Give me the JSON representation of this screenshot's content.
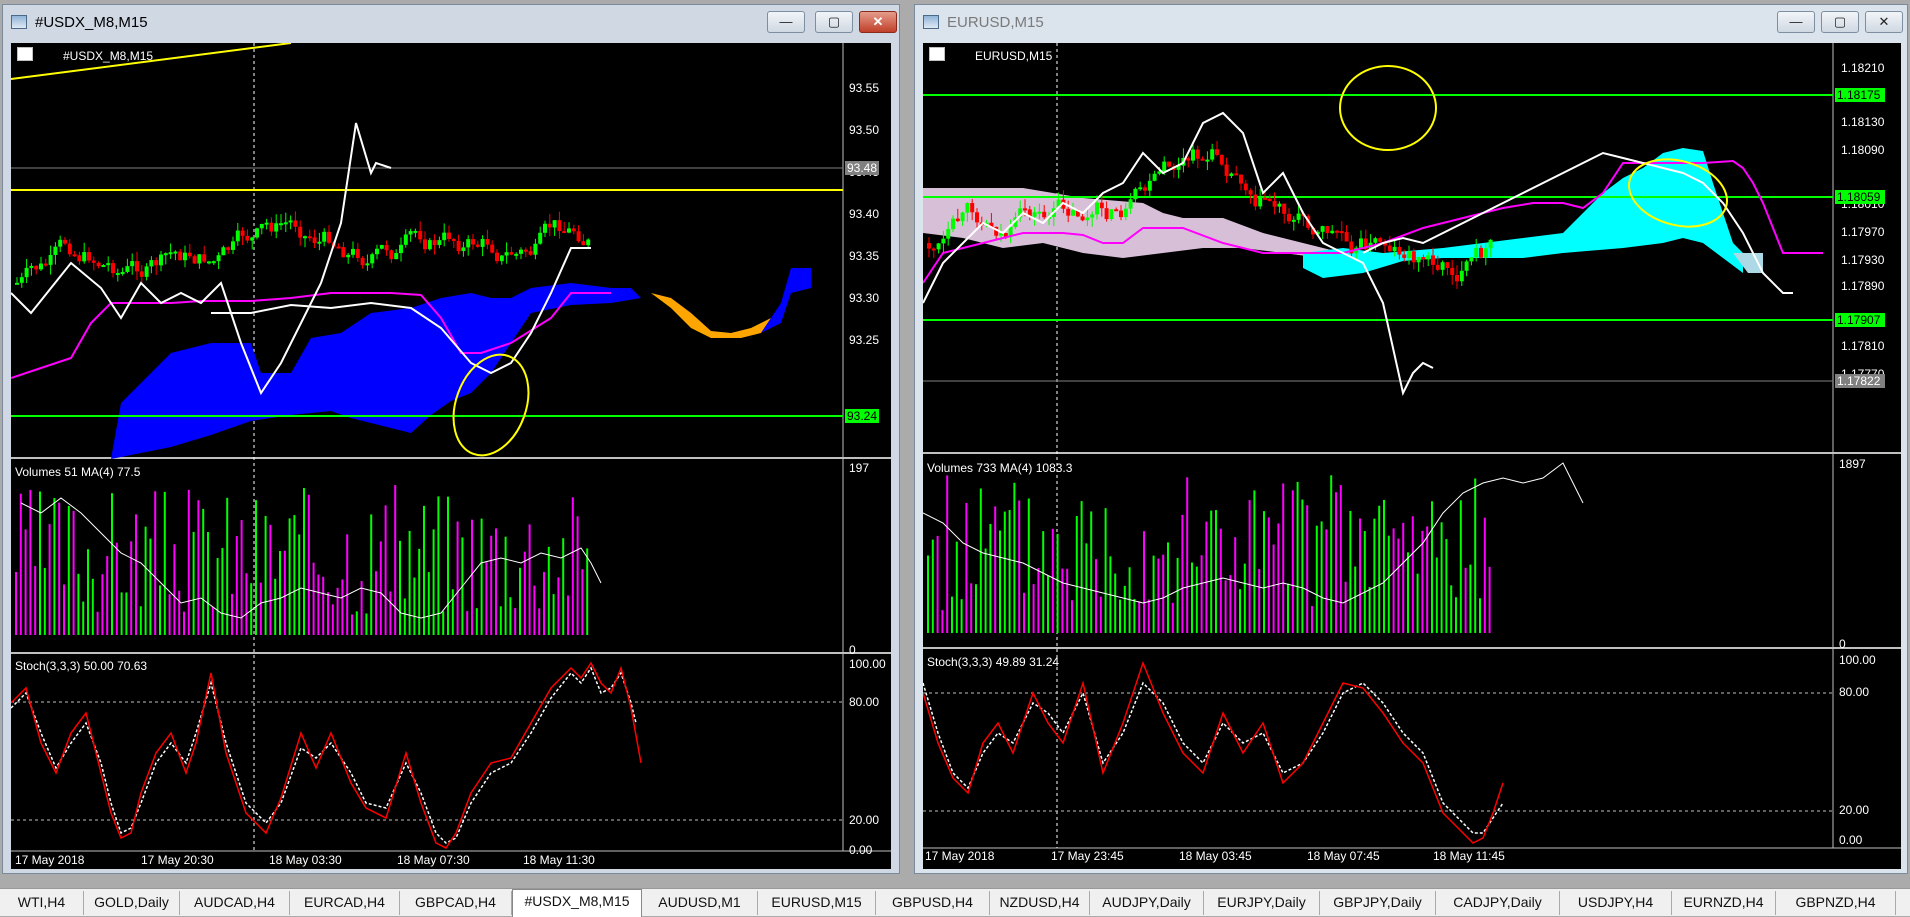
{
  "left_window": {
    "title": "#USDX_M8,M15",
    "chart_label": "#USDX_M8,M15",
    "volume_label": "Volumes 51 MA(4) 77.5",
    "stoch_label": "Stoch(3,3,3) 50.00 70.63",
    "price_ticks": [
      "93.55",
      "93.50",
      "93.45",
      "93.40",
      "93.35",
      "93.30",
      "93.25"
    ],
    "bid_marker": "93.48",
    "line_marker": "93.24",
    "volume_ticks": [
      "197",
      "0"
    ],
    "stoch_ticks": [
      "100.00",
      "80.00",
      "20.00",
      "0.00"
    ],
    "time_labels": [
      "17 May 2018",
      "17 May 20:30",
      "18 May 03:30",
      "18 May 07:30",
      "18 May 11:30"
    ]
  },
  "right_window": {
    "title": "EURUSD,M15",
    "chart_label": "EURUSD,M15",
    "volume_label": "Volumes 733 MA(4) 1083.3",
    "stoch_label": "Stoch(3,3,3) 49.89 31.24",
    "price_ticks": [
      "1.18210",
      "1.18130",
      "1.18090",
      "1.18010",
      "1.17970",
      "1.17930",
      "1.17890",
      "1.17850",
      "1.17810",
      "1.17770"
    ],
    "upper_marker": "1.18175",
    "mid_marker": "1.18059",
    "lower_marker": "1.17907",
    "bid_marker": "1.17822",
    "volume_ticks": [
      "1897",
      "0"
    ],
    "stoch_ticks": [
      "100.00",
      "80.00",
      "20.00",
      "0.00"
    ],
    "time_labels": [
      "17 May 2018",
      "17 May 23:45",
      "18 May 03:45",
      "18 May 07:45",
      "18 May 11:45"
    ]
  },
  "window_buttons": {
    "minimize": "—",
    "maximize": "▢",
    "close": "✕"
  },
  "tabs": [
    {
      "label": "WTI,H4",
      "active": false
    },
    {
      "label": "GOLD,Daily",
      "active": false
    },
    {
      "label": "AUDCAD,H4",
      "active": false
    },
    {
      "label": "EURCAD,H4",
      "active": false
    },
    {
      "label": "GBPCAD,H4",
      "active": false
    },
    {
      "label": "#USDX_M8,M15",
      "active": true
    },
    {
      "label": "AUDUSD,M1",
      "active": false
    },
    {
      "label": "EURUSD,M15",
      "active": false
    },
    {
      "label": "GBPUSD,H4",
      "active": false
    },
    {
      "label": "NZDUSD,H4",
      "active": false
    },
    {
      "label": "AUDJPY,Daily",
      "active": false
    },
    {
      "label": "EURJPY,Daily",
      "active": false
    },
    {
      "label": "GBPJPY,Daily",
      "active": false
    },
    {
      "label": "CADJPY,Daily",
      "active": false
    },
    {
      "label": "USDJPY,H4",
      "active": false
    },
    {
      "label": "EURNZD,H4",
      "active": false
    },
    {
      "label": "GBPNZD,H4",
      "active": false
    }
  ],
  "colors": {
    "up_candle": "#00ff00",
    "down_candle": "#ff0000",
    "cloud_left": "#0000ff",
    "cloud_left_alt": "#ffa500",
    "cloud_right": "#00ffff",
    "cloud_right_alt": "#d8bfd8",
    "kijun": "#ff00ff",
    "tenkan": "#ffffff",
    "level_line": "#00ff00",
    "trend_line": "#ffff00",
    "volume_up": "#00ff00",
    "volume_down": "#ff00ff",
    "stoch_main": "#ff0000"
  }
}
